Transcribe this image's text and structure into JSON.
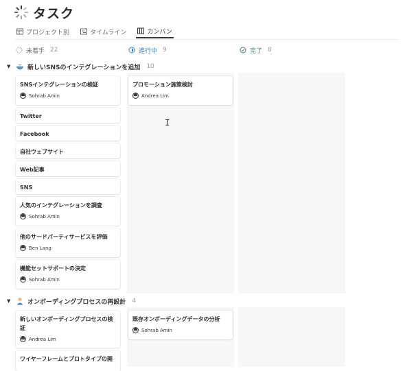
{
  "page": {
    "title": "タスク",
    "icon": "loading-spinner-icon"
  },
  "tabs": [
    {
      "label": "プロジェクト別",
      "icon": "table-icon",
      "active": false
    },
    {
      "label": "タイムライン",
      "icon": "timeline-icon",
      "active": false
    },
    {
      "label": "カンバン",
      "icon": "board-icon",
      "active": true
    }
  ],
  "columns": [
    {
      "label": "未着手",
      "count": "22",
      "icon": "circle-dashed-icon",
      "color": "#9b9a97"
    },
    {
      "label": "進行中",
      "count": "9",
      "icon": "in-progress-icon",
      "color": "#2e7dbd"
    },
    {
      "label": "完了",
      "count": "8",
      "icon": "check-circle-icon",
      "color": "#448361"
    }
  ],
  "groups": [
    {
      "title": "新しいSNSのインテグレーションを追加",
      "count": "10",
      "icon": "bowl-icon",
      "todo": [
        {
          "title": "SNSインテグレーションの検証",
          "person": "Sohrab Amin"
        },
        {
          "title": "Twitter"
        },
        {
          "title": "Facebook"
        },
        {
          "title": "自社ウェブサイト"
        },
        {
          "title": "Web記事"
        },
        {
          "title": "SNS"
        },
        {
          "title": "人気のインテグレーションを調査",
          "person": "Sohrab Amin"
        },
        {
          "title": "他のサードパーティサービスを評価",
          "person": "Ben Lang"
        },
        {
          "title": "機能セットサポートの決定",
          "person": "Sohrab Amin"
        }
      ],
      "doing": [
        {
          "title": "プロモーション施策検討",
          "person": "Andrea Lim"
        }
      ]
    },
    {
      "title": "オンボーディングプロセスの再設計",
      "count": "4",
      "icon": "person-icon",
      "todo": [
        {
          "title_line1": "新しいオンボーディングプロセスの検",
          "title_line2": "証",
          "person": "Andrea Lim"
        },
        {
          "title": "ワイヤーフレームとプロトタイプの開"
        }
      ],
      "doing": [
        {
          "title": "既存オンボーディングデータの分析",
          "person": "Sohrab Amin"
        }
      ]
    }
  ]
}
